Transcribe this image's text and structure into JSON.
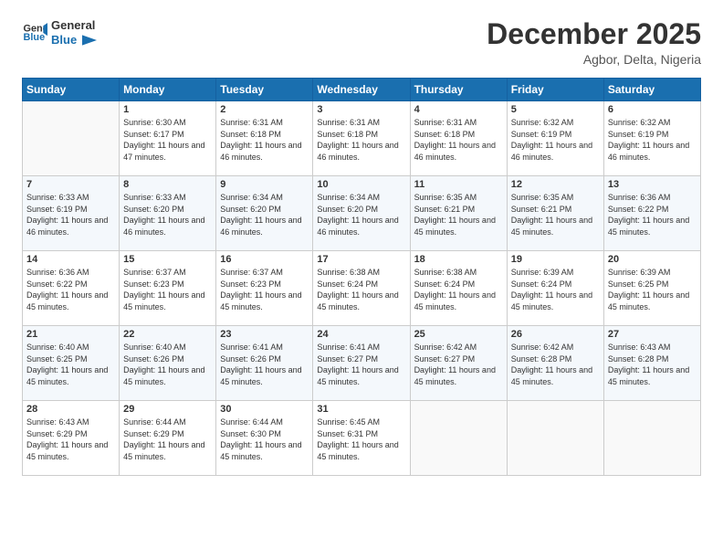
{
  "logo": {
    "text_general": "General",
    "text_blue": "Blue"
  },
  "header": {
    "month": "December 2025",
    "location": "Agbor, Delta, Nigeria"
  },
  "weekdays": [
    "Sunday",
    "Monday",
    "Tuesday",
    "Wednesday",
    "Thursday",
    "Friday",
    "Saturday"
  ],
  "weeks": [
    [
      {
        "day": "",
        "empty": true
      },
      {
        "day": "1",
        "sunrise": "6:30 AM",
        "sunset": "6:17 PM",
        "daylight": "11 hours and 47 minutes."
      },
      {
        "day": "2",
        "sunrise": "6:31 AM",
        "sunset": "6:18 PM",
        "daylight": "11 hours and 46 minutes."
      },
      {
        "day": "3",
        "sunrise": "6:31 AM",
        "sunset": "6:18 PM",
        "daylight": "11 hours and 46 minutes."
      },
      {
        "day": "4",
        "sunrise": "6:31 AM",
        "sunset": "6:18 PM",
        "daylight": "11 hours and 46 minutes."
      },
      {
        "day": "5",
        "sunrise": "6:32 AM",
        "sunset": "6:19 PM",
        "daylight": "11 hours and 46 minutes."
      },
      {
        "day": "6",
        "sunrise": "6:32 AM",
        "sunset": "6:19 PM",
        "daylight": "11 hours and 46 minutes."
      }
    ],
    [
      {
        "day": "7",
        "sunrise": "6:33 AM",
        "sunset": "6:19 PM",
        "daylight": "11 hours and 46 minutes."
      },
      {
        "day": "8",
        "sunrise": "6:33 AM",
        "sunset": "6:20 PM",
        "daylight": "11 hours and 46 minutes."
      },
      {
        "day": "9",
        "sunrise": "6:34 AM",
        "sunset": "6:20 PM",
        "daylight": "11 hours and 46 minutes."
      },
      {
        "day": "10",
        "sunrise": "6:34 AM",
        "sunset": "6:20 PM",
        "daylight": "11 hours and 46 minutes."
      },
      {
        "day": "11",
        "sunrise": "6:35 AM",
        "sunset": "6:21 PM",
        "daylight": "11 hours and 45 minutes."
      },
      {
        "day": "12",
        "sunrise": "6:35 AM",
        "sunset": "6:21 PM",
        "daylight": "11 hours and 45 minutes."
      },
      {
        "day": "13",
        "sunrise": "6:36 AM",
        "sunset": "6:22 PM",
        "daylight": "11 hours and 45 minutes."
      }
    ],
    [
      {
        "day": "14",
        "sunrise": "6:36 AM",
        "sunset": "6:22 PM",
        "daylight": "11 hours and 45 minutes."
      },
      {
        "day": "15",
        "sunrise": "6:37 AM",
        "sunset": "6:23 PM",
        "daylight": "11 hours and 45 minutes."
      },
      {
        "day": "16",
        "sunrise": "6:37 AM",
        "sunset": "6:23 PM",
        "daylight": "11 hours and 45 minutes."
      },
      {
        "day": "17",
        "sunrise": "6:38 AM",
        "sunset": "6:24 PM",
        "daylight": "11 hours and 45 minutes."
      },
      {
        "day": "18",
        "sunrise": "6:38 AM",
        "sunset": "6:24 PM",
        "daylight": "11 hours and 45 minutes."
      },
      {
        "day": "19",
        "sunrise": "6:39 AM",
        "sunset": "6:24 PM",
        "daylight": "11 hours and 45 minutes."
      },
      {
        "day": "20",
        "sunrise": "6:39 AM",
        "sunset": "6:25 PM",
        "daylight": "11 hours and 45 minutes."
      }
    ],
    [
      {
        "day": "21",
        "sunrise": "6:40 AM",
        "sunset": "6:25 PM",
        "daylight": "11 hours and 45 minutes."
      },
      {
        "day": "22",
        "sunrise": "6:40 AM",
        "sunset": "6:26 PM",
        "daylight": "11 hours and 45 minutes."
      },
      {
        "day": "23",
        "sunrise": "6:41 AM",
        "sunset": "6:26 PM",
        "daylight": "11 hours and 45 minutes."
      },
      {
        "day": "24",
        "sunrise": "6:41 AM",
        "sunset": "6:27 PM",
        "daylight": "11 hours and 45 minutes."
      },
      {
        "day": "25",
        "sunrise": "6:42 AM",
        "sunset": "6:27 PM",
        "daylight": "11 hours and 45 minutes."
      },
      {
        "day": "26",
        "sunrise": "6:42 AM",
        "sunset": "6:28 PM",
        "daylight": "11 hours and 45 minutes."
      },
      {
        "day": "27",
        "sunrise": "6:43 AM",
        "sunset": "6:28 PM",
        "daylight": "11 hours and 45 minutes."
      }
    ],
    [
      {
        "day": "28",
        "sunrise": "6:43 AM",
        "sunset": "6:29 PM",
        "daylight": "11 hours and 45 minutes."
      },
      {
        "day": "29",
        "sunrise": "6:44 AM",
        "sunset": "6:29 PM",
        "daylight": "11 hours and 45 minutes."
      },
      {
        "day": "30",
        "sunrise": "6:44 AM",
        "sunset": "6:30 PM",
        "daylight": "11 hours and 45 minutes."
      },
      {
        "day": "31",
        "sunrise": "6:45 AM",
        "sunset": "6:31 PM",
        "daylight": "11 hours and 45 minutes."
      },
      {
        "day": "",
        "empty": true
      },
      {
        "day": "",
        "empty": true
      },
      {
        "day": "",
        "empty": true
      }
    ]
  ]
}
